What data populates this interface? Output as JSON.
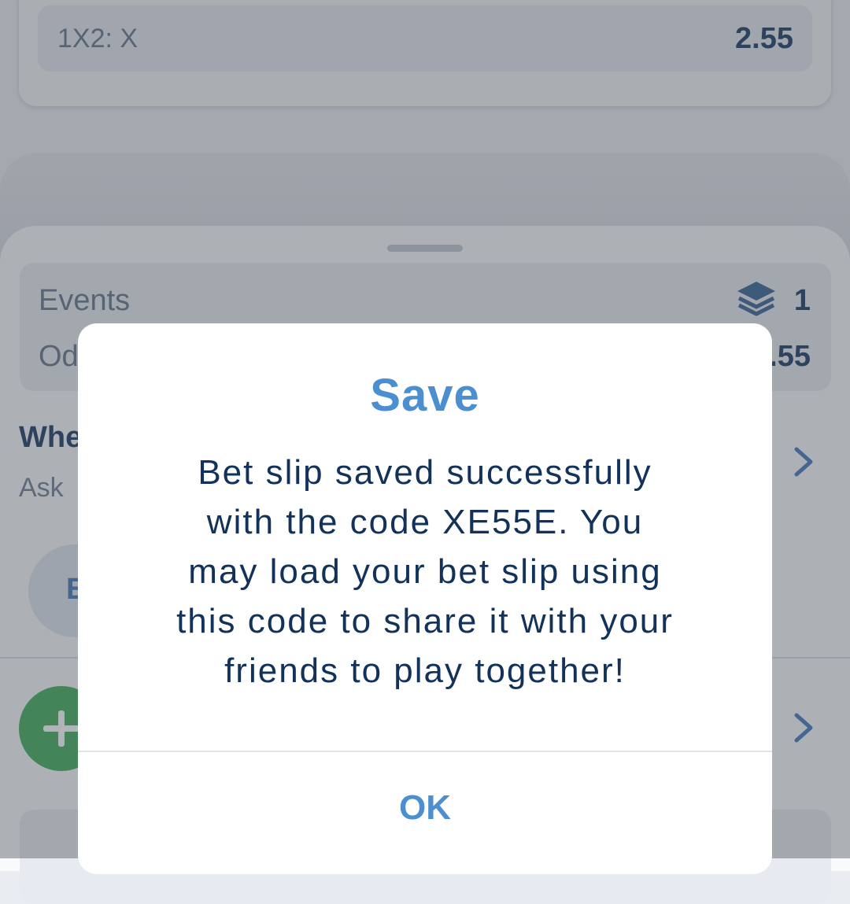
{
  "selection": {
    "market": "1X2: X",
    "odd": "2.55"
  },
  "summary": {
    "events_label": "Events",
    "events_value": "1",
    "odds_label": "Odds",
    "odds_value": "2.55"
  },
  "section": {
    "heading": "Whe",
    "subtext": "Ask",
    "pill_label": "E"
  },
  "dialog": {
    "title": "Save",
    "message_lines": [
      "Bet slip saved successfully",
      "with the code XE55E. You",
      "may load your bet slip using",
      "this code to share it with your",
      "friends to play together!"
    ],
    "ok_label": "OK"
  },
  "icons": {
    "events": "layers-icon",
    "chevron": "chevron-right-icon",
    "add": "plus-icon"
  },
  "colors": {
    "accent": "#4b8fd1",
    "text_dark": "#12325a",
    "add_button": "#3aab53"
  }
}
